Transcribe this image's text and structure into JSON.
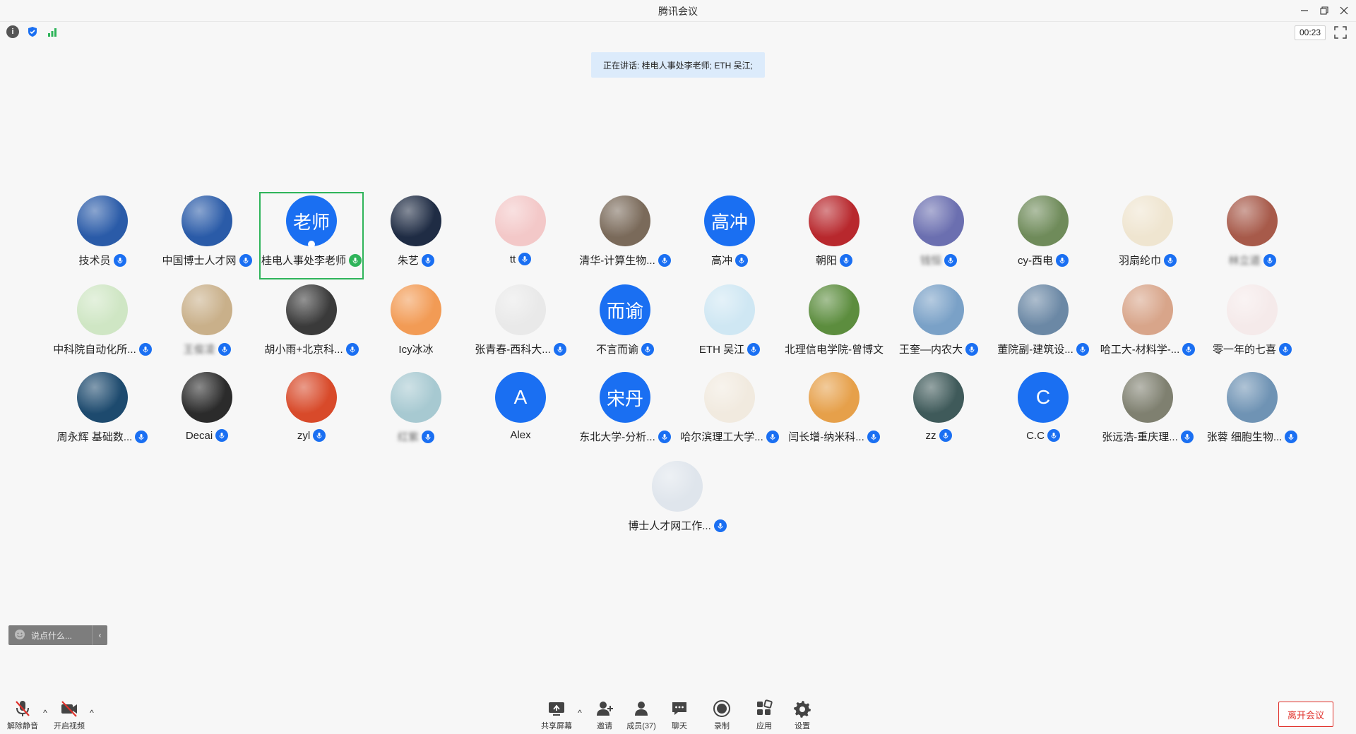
{
  "window": {
    "title": "腾讯会议"
  },
  "topbar": {
    "timer": "00:23"
  },
  "speaking": {
    "text": "正在讲话: 桂电人事处李老师; ETH 吴江;"
  },
  "participants": [
    {
      "name": "技术员",
      "avatar": "img",
      "color": "#2a5ba8",
      "icon": "graduation-cap-icon",
      "mic": "blue",
      "row": 0,
      "col": 0
    },
    {
      "name": "中国博士人才网",
      "avatar": "img",
      "color": "#2a5ba8",
      "icon": "graduation-cap-icon",
      "mic": "blue",
      "row": 0,
      "col": 1
    },
    {
      "name": "桂电人事处李老师",
      "avatar": "text",
      "avatar_text": "老师",
      "mic": "green",
      "active": true,
      "row": 0,
      "col": 2
    },
    {
      "name": "朱艺",
      "avatar": "img",
      "color": "#1f2c44",
      "icon": "night-road-icon",
      "mic": "blue",
      "row": 0,
      "col": 3
    },
    {
      "name": "tt",
      "avatar": "img",
      "color": "#f3c8c8",
      "icon": "cartoon-girl-icon",
      "mic": "blue",
      "row": 0,
      "col": 4
    },
    {
      "name": "清华-计算生物...",
      "avatar": "img",
      "color": "#7a6a5a",
      "icon": "rocks-photo-icon",
      "mic": "blue",
      "row": 0,
      "col": 5
    },
    {
      "name": "高冲",
      "avatar": "text",
      "avatar_text": "高冲",
      "mic": "blue",
      "row": 0,
      "col": 6
    },
    {
      "name": "朝阳",
      "avatar": "img",
      "color": "#b8282d",
      "icon": "football-player-icon",
      "mic": "blue",
      "row": 0,
      "col": 7
    },
    {
      "name": "钱恒",
      "avatar": "img",
      "color": "#6b6fb0",
      "icon": "bridge-photo-icon",
      "mic": "blue",
      "blur": true,
      "row": 0,
      "col": 8
    },
    {
      "name": "cy-西电",
      "avatar": "img",
      "color": "#6f8b5a",
      "icon": "bird-photo-icon",
      "mic": "blue",
      "row": 0,
      "col": 9
    },
    {
      "name": "羽扇纶巾",
      "avatar": "img",
      "color": "#efe5d0",
      "icon": "sketch-icon",
      "mic": "blue",
      "row": 0,
      "col": 10
    },
    {
      "name": "林立道",
      "avatar": "img",
      "color": "#a75a4a",
      "icon": "person-photo-icon",
      "mic": "blue",
      "blur": true,
      "row": 0,
      "col": 11
    },
    {
      "name": "中科院自动化所...",
      "avatar": "img",
      "color": "#cfe6c4",
      "icon": "flower-photo-icon",
      "mic": "blue",
      "row": 1,
      "col": 0
    },
    {
      "name": "王俊凌",
      "avatar": "img",
      "color": "#c9b08a",
      "icon": "dog-photo-icon",
      "mic": "blue",
      "blur": true,
      "row": 1,
      "col": 1
    },
    {
      "name": "胡小雨+北京科...",
      "avatar": "img",
      "color": "#3a3a3a",
      "icon": "girl-portrait-icon",
      "mic": "blue",
      "row": 1,
      "col": 2
    },
    {
      "name": "Icy冰冰",
      "avatar": "img",
      "color": "#f29b55",
      "icon": "cartoon-dog-icon",
      "mic": "none",
      "row": 1,
      "col": 3
    },
    {
      "name": "张青春-西科大...",
      "avatar": "img",
      "color": "#e9e9e9",
      "icon": "cartoon-boy-icon",
      "mic": "blue",
      "row": 1,
      "col": 4
    },
    {
      "name": "不言而谕",
      "avatar": "text",
      "avatar_text": "而谕",
      "mic": "blue",
      "row": 1,
      "col": 5
    },
    {
      "name": "ETH 吴江",
      "avatar": "img",
      "color": "#cfe7f3",
      "icon": "person-cartoon-icon",
      "mic": "blue-speaking",
      "row": 1,
      "col": 6
    },
    {
      "name": "北理信电学院-曾博文",
      "avatar": "img",
      "color": "#5c8d3e",
      "icon": "lotus-photo-icon",
      "mic": "none",
      "row": 1,
      "col": 7
    },
    {
      "name": "王奎—内农大",
      "avatar": "img",
      "color": "#7aa1c7",
      "icon": "sailboat-photo-icon",
      "mic": "blue",
      "row": 1,
      "col": 8
    },
    {
      "name": "董院副-建筑设...",
      "avatar": "img",
      "color": "#6b88a5",
      "icon": "couple-photo-icon",
      "mic": "blue",
      "blur_prefix": true,
      "row": 1,
      "col": 9
    },
    {
      "name": "哈工大-材料学-...",
      "avatar": "img",
      "color": "#d8a58a",
      "icon": "baby-photo-icon",
      "mic": "blue",
      "row": 1,
      "col": 10
    },
    {
      "name": "零一年的七喜",
      "avatar": "img",
      "color": "#f5eaea",
      "icon": "seal-stamp-icon",
      "mic": "blue",
      "row": 1,
      "col": 11
    },
    {
      "name": "周永辉 基础数...",
      "avatar": "img",
      "color": "#1d4a6e",
      "icon": "earth-photo-icon",
      "mic": "blue",
      "blur_prefix": true,
      "row": 2,
      "col": 0
    },
    {
      "name": "Decai",
      "avatar": "img",
      "color": "#2b2b2b",
      "icon": "football-player-icon",
      "mic": "blue",
      "row": 2,
      "col": 1
    },
    {
      "name": "zyl",
      "avatar": "img",
      "color": "#d84a2a",
      "icon": "anime-boy-icon",
      "mic": "blue",
      "row": 2,
      "col": 2
    },
    {
      "name": "红紫",
      "avatar": "img",
      "color": "#a7c9d1",
      "icon": "woman-portrait-icon",
      "mic": "blue",
      "blur": true,
      "row": 2,
      "col": 3
    },
    {
      "name": "Alex",
      "avatar": "text",
      "avatar_text": "A",
      "mic": "none",
      "row": 2,
      "col": 4
    },
    {
      "name": "东北大学-分析...",
      "avatar": "text",
      "avatar_text": "宋丹",
      "mic": "blue",
      "row": 2,
      "col": 5
    },
    {
      "name": "哈尔滨理工大学...",
      "avatar": "img",
      "color": "#f1eadf",
      "icon": "calligraphy-icon",
      "mic": "blue",
      "row": 2,
      "col": 6
    },
    {
      "name": "闫长增-纳米科...",
      "avatar": "img",
      "color": "#e6a04a",
      "icon": "palm-trees-icon",
      "mic": "blue",
      "row": 2,
      "col": 7
    },
    {
      "name": "zz",
      "avatar": "img",
      "color": "#3f5a5a",
      "icon": "manatee-photo-icon",
      "mic": "blue",
      "row": 2,
      "col": 8
    },
    {
      "name": "C.C",
      "avatar": "text",
      "avatar_text": "C",
      "mic": "blue",
      "row": 2,
      "col": 9
    },
    {
      "name": "张远浩-重庆理...",
      "avatar": "img",
      "color": "#7f8070",
      "icon": "street-photo-icon",
      "mic": "blue",
      "blur_prefix": true,
      "row": 2,
      "col": 10
    },
    {
      "name": "张蓉 细胞生物...",
      "avatar": "img",
      "color": "#6f93b4",
      "icon": "lake-photo-icon",
      "mic": "blue",
      "blur_prefix": true,
      "row": 2,
      "col": 11
    },
    {
      "name": "博士人才网工作...",
      "avatar": "img",
      "color": "#dfe5ec",
      "icon": "person-cartoon-icon",
      "mic": "blue",
      "row": 3,
      "col": 5.5
    }
  ],
  "chat": {
    "placeholder": "说点什么..."
  },
  "toolbar": {
    "unmute": "解除静音",
    "video": "开启视频",
    "share": "共享屏幕",
    "invite": "邀请",
    "members": "成员(37)",
    "chat": "聊天",
    "record": "录制",
    "apps": "应用",
    "settings": "设置",
    "leave": "离开会议"
  }
}
